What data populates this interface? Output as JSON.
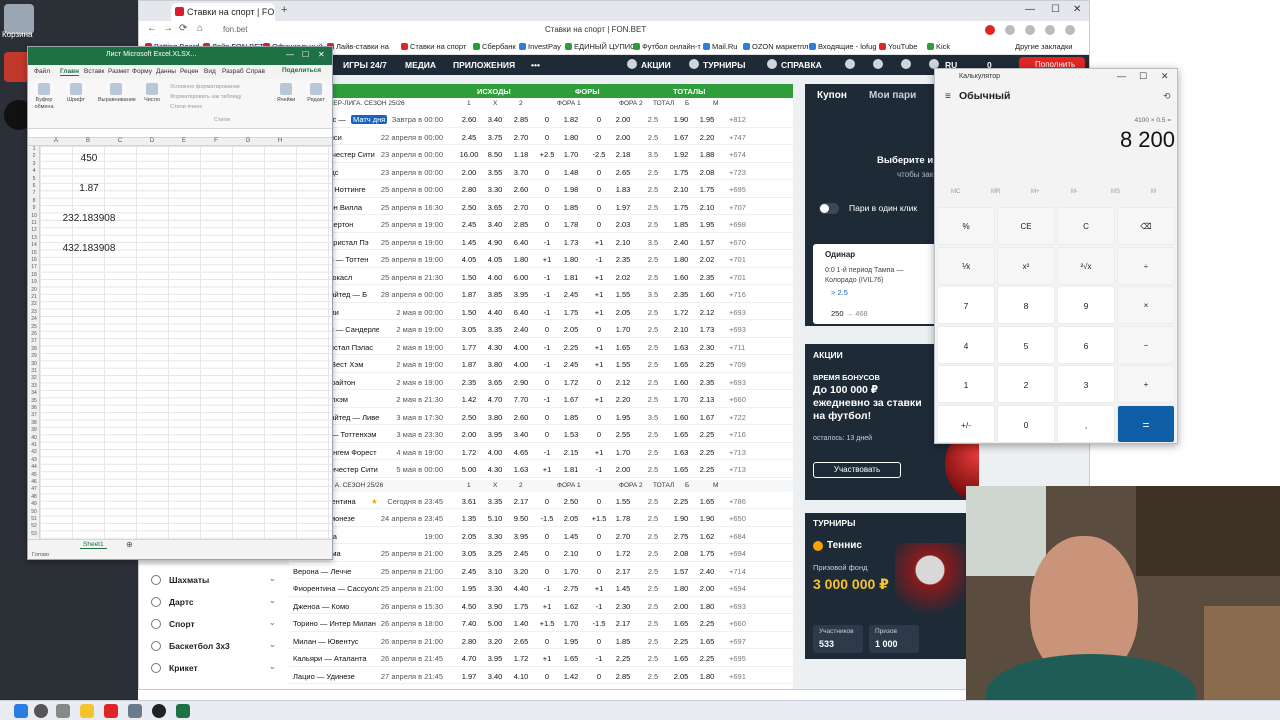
{
  "desktop": {
    "icons": [
      "Корзина"
    ]
  },
  "browser": {
    "tab_title": "Ставки на спорт | FON.BET",
    "url": "fon.bet",
    "page_title": "Ставки на спорт | FON.BET",
    "bookmarks": [
      "Betting Board",
      "Лайв FON.BET",
      "Официальный",
      "Лайв-ставки на",
      "Ставки на спорт",
      "Сбербанк",
      "InvestPay",
      "ЕДИНЫЙ ЦУПИС",
      "Футбол онлайн-т",
      "Mail.Ru",
      "OZON маркетпл",
      "Входящие - lofug",
      "YouTube",
      "Kick",
      "Другие закладки"
    ]
  },
  "fonbet_header": {
    "items": [
      "ИГРЫ 24/7",
      "МЕДИА",
      "ПРИЛОЖЕНИЯ",
      "•••",
      "АКЦИИ",
      "ТУРНИРЫ",
      "СПРАВКА"
    ],
    "lang": "RU",
    "balance": "0",
    "deposit": "Пополнить"
  },
  "odds_table": {
    "section1": {
      "title": "тбол",
      "groups": [
        "ИСХОДЫ",
        "ФОРЫ",
        "ТОТАЛЫ"
      ],
      "league": "ЛИЯ. ПРЕМЬЕР-ЛИГА. СЕЗОН 25/26",
      "cols": [
        "1",
        "X",
        "2",
        "ФОРА 1",
        "ФОРА 2",
        "ТОТАЛ",
        "Б",
        "М"
      ],
      "rows": [
        {
          "team": "истал Пэлас —",
          "badge": "Матч дня",
          "date": "Завтра в 00:00",
          "o": [
            "2.60",
            "3.40",
            "2.85",
            "0",
            "1.82",
            "0",
            "2.00",
            "2.5",
            "1.90",
            "1.95"
          ],
          "more": "+812"
        },
        {
          "team": "йтон — Челси",
          "date": "22 апреля в 00:00",
          "o": [
            "2.45",
            "3.75",
            "2.70",
            "0",
            "1.80",
            "0",
            "2.00",
            "2.5",
            "1.67",
            "2.20"
          ],
          "more": "+747"
        },
        {
          "team": "нли — Манчестер Сити",
          "date": "23 апреля в 00:00",
          "o": [
            "16.00",
            "8.50",
            "1.18",
            "+2.5",
            "1.70",
            "-2.5",
            "2.18",
            "3.5",
            "1.92",
            "1.88"
          ],
          "more": "+674"
        },
        {
          "team": "нмут — Лидс",
          "date": "23 апреля в 00:00",
          "o": [
            "2.00",
            "3.55",
            "3.70",
            "0",
            "1.48",
            "0",
            "2.65",
            "2.5",
            "1.75",
            "2.08"
          ],
          "more": "+723"
        },
        {
          "team": "дерленд — Ноттинге",
          "date": "25 апреля в 00:00",
          "o": [
            "2.80",
            "3.30",
            "2.60",
            "0",
            "1.98",
            "0",
            "1.83",
            "2.5",
            "2.10",
            "1.75"
          ],
          "more": "+695"
        },
        {
          "team": "хэм — Астон Вилла",
          "date": "25 апреля в 16:30",
          "o": [
            "2.50",
            "3.65",
            "2.70",
            "0",
            "1.85",
            "0",
            "1.97",
            "2.5",
            "1.75",
            "2.10"
          ],
          "more": "+707"
        },
        {
          "team": "т Хэм — Эвертон",
          "date": "25 апреля в 19:00",
          "o": [
            "2.45",
            "3.40",
            "2.85",
            "0",
            "1.78",
            "0",
            "2.03",
            "2.5",
            "1.85",
            "1.95"
          ],
          "more": "+698"
        },
        {
          "team": "ерпуль — Кристал Пэ",
          "date": "25 апреля в 19:00",
          "o": [
            "1.45",
            "4.90",
            "6.40",
            "-1",
            "1.73",
            "+1",
            "2.10",
            "3.5",
            "2.40",
            "1.57"
          ],
          "more": "+670"
        },
        {
          "team": "верхэмптон — Тоттен",
          "date": "25 апреля в 19:00",
          "o": [
            "4.05",
            "4.05",
            "1.80",
            "+1",
            "1.80",
            "-1",
            "2.35",
            "2.5",
            "1.80",
            "2.02"
          ],
          "more": "+701"
        },
        {
          "team": "енал — Ньюкасл",
          "date": "25 апреля в 21:30",
          "o": [
            "1.50",
            "4.60",
            "6.00",
            "-1",
            "1.81",
            "+1",
            "2.02",
            "2.5",
            "1.60",
            "2.35"
          ],
          "more": "+701"
        },
        {
          "team": "честер Юнайтед — Б",
          "date": "28 апреля в 00:00",
          "o": [
            "1.87",
            "3.85",
            "3.95",
            "-1",
            "2.45",
            "+1",
            "1.55",
            "3.5",
            "2.35",
            "1.60"
          ],
          "more": "+716"
        },
        {
          "team": "дс — Бернли",
          "date": "2 мая в 00:00",
          "o": [
            "1.50",
            "4.40",
            "6.40",
            "-1",
            "1.75",
            "+1",
            "2.05",
            "2.5",
            "1.72",
            "2.12"
          ],
          "more": "+693"
        },
        {
          "team": "верхэмптон — Сандерленд",
          "date": "2 мая в 19:00",
          "o": [
            "3.05",
            "3.35",
            "2.40",
            "0",
            "2.05",
            "0",
            "1.70",
            "2.5",
            "2.10",
            "1.73"
          ],
          "more": "+693"
        },
        {
          "team": "нмут — Кристал Пэлас",
          "date": "2 мая в 19:00",
          "o": [
            "1.77",
            "4.30",
            "4.00",
            "-1",
            "2.25",
            "+1",
            "1.65",
            "2.5",
            "1.63",
            "2.30"
          ],
          "more": "+711"
        },
        {
          "team": "нтфорд — Вест Хэм",
          "date": "2 мая в 19:00",
          "o": [
            "1.87",
            "3.80",
            "4.00",
            "-1",
            "2.45",
            "+1",
            "1.55",
            "2.5",
            "1.65",
            "2.25"
          ],
          "more": "+709"
        },
        {
          "team": "юкасл — Брайтон",
          "date": "2 мая в 19:00",
          "o": [
            "2.35",
            "3.65",
            "2.90",
            "0",
            "1.72",
            "0",
            "2.12",
            "2.5",
            "1.60",
            "2.35"
          ],
          "more": "+693"
        },
        {
          "team": "енал — Фулхэм",
          "date": "2 мая в 21:30",
          "o": [
            "1.42",
            "4.70",
            "7.70",
            "-1",
            "1.67",
            "+1",
            "2.20",
            "2.5",
            "1.70",
            "2.13"
          ],
          "more": "+660"
        },
        {
          "team": "честер Юнайтед — Ливер",
          "date": "3 мая в 17:30",
          "o": [
            "2.50",
            "3.80",
            "2.60",
            "0",
            "1.85",
            "0",
            "1.95",
            "3.5",
            "1.60",
            "1.67"
          ],
          "more": "+722"
        },
        {
          "team": "тон Вилла — Тоттенхэм",
          "date": "3 мая в 23:30",
          "o": [
            "2.00",
            "3.95",
            "3.40",
            "0",
            "1.53",
            "0",
            "2.55",
            "2.5",
            "1.65",
            "2.25"
          ],
          "more": "+716"
        },
        {
          "team": "си — Ноттингем Форест",
          "date": "4 мая в 19:00",
          "o": [
            "1.72",
            "4.00",
            "4.65",
            "-1",
            "2.15",
            "+1",
            "1.70",
            "2.5",
            "1.63",
            "2.25"
          ],
          "more": "+713"
        },
        {
          "team": "ртон — Манчестер Сити",
          "date": "5 мая в 00:00",
          "o": [
            "5.00",
            "4.30",
            "1.63",
            "+1",
            "1.81",
            "-1",
            "2.00",
            "2.5",
            "1.65",
            "2.25"
          ],
          "more": "+713"
        }
      ]
    },
    "section2": {
      "league": "ЛИЯ. СЕРИЯ А. СЕЗОН 25/26",
      "cols": [
        "1",
        "X",
        "2",
        "ФОРА 1",
        "ФОРА 2",
        "ТОТАЛ",
        "Б",
        "М"
      ],
      "rows": [
        {
          "team": "ли — Фиорентина",
          "date": "Сегодня в 23:45",
          "star": true,
          "o": [
            "3.61",
            "3.35",
            "2.17",
            "0",
            "2.50",
            "0",
            "1.55",
            "2.5",
            "2.25",
            "1.65"
          ],
          "more": "+786"
        },
        {
          "team": "оли — Кремонезе",
          "date": "24 апреля в 23:45",
          "o": [
            "1.35",
            "5.10",
            "9.50",
            "-1.5",
            "2.05",
            "+1.5",
            "1.78",
            "2.5",
            "1.90",
            "1.90"
          ],
          "more": "+650"
        },
        {
          "team": "нтус — Пиза",
          "date": "19:00",
          "o": [
            "2.05",
            "3.30",
            "3.95",
            "0",
            "1.45",
            "0",
            "2.70",
            "2.5",
            "2.75",
            "1.62"
          ],
          "more": "+684"
        },
        {
          "team": "ньюа — Рома",
          "date": "25 апреля в 21:00",
          "o": [
            "3.05",
            "3.25",
            "2.45",
            "0",
            "2.10",
            "0",
            "1.72",
            "2.5",
            "2.08",
            "1.75"
          ],
          "more": "+694"
        },
        {
          "team": "Верона — Лечче",
          "date": "25 апреля в 21:00",
          "o": [
            "2.45",
            "3.10",
            "3.20",
            "0",
            "1.70",
            "0",
            "2.17",
            "2.5",
            "1.57",
            "2.40"
          ],
          "more": "+714"
        },
        {
          "team": "Фиорентина — Сассуоло",
          "date": "25 апреля в 21:00",
          "o": [
            "1.95",
            "3.30",
            "4.40",
            "-1",
            "2.75",
            "+1",
            "1.45",
            "2.5",
            "1.80",
            "2.00"
          ],
          "more": "+694"
        },
        {
          "team": "Дженоа — Комо",
          "date": "26 апреля в 15:30",
          "o": [
            "4.50",
            "3.90",
            "1.75",
            "+1",
            "1.62",
            "-1",
            "2.30",
            "2.5",
            "2.00",
            "1.80"
          ],
          "more": "+693"
        },
        {
          "team": "Торино — Интер Милан",
          "date": "26 апреля в 18:00",
          "o": [
            "7.40",
            "5.00",
            "1.40",
            "+1.5",
            "1.70",
            "-1.5",
            "2.17",
            "2.5",
            "1.65",
            "2.25"
          ],
          "more": "+660"
        },
        {
          "team": "Милан — Ювентус",
          "date": "26 апреля в 21:00",
          "o": [
            "2.80",
            "3.20",
            "2.65",
            "0",
            "1.95",
            "0",
            "1.85",
            "2.5",
            "2.25",
            "1.65"
          ],
          "more": "+697"
        },
        {
          "team": "Кальяри — Аталанта",
          "date": "26 апреля в 21:45",
          "o": [
            "4.70",
            "3.95",
            "1.72",
            "+1",
            "1.65",
            "-1",
            "2.25",
            "2.5",
            "1.65",
            "2.25"
          ],
          "more": "+695"
        },
        {
          "team": "Лацио — Удинезе",
          "date": "27 апреля в 21:45",
          "o": [
            "1.97",
            "3.40",
            "4.10",
            "0",
            "1.42",
            "0",
            "2.85",
            "2.5",
            "2.05",
            "1.80"
          ],
          "more": "+691"
        }
      ]
    }
  },
  "sports_sidebar": [
    "Шахматы",
    "Дартс",
    "Спорт",
    "Баскетбол 3х3",
    "Крикет"
  ],
  "coupon": {
    "title": "Купон",
    "tab2": "Мои пари",
    "choose": "Выберите и",
    "choose2": "чтобы зак",
    "one_click": "Пари в один клик",
    "bet_type": "Одинар",
    "bet_desc": "0:0 1-й период Тампа — Колорадо (IVIL76)",
    "bet_odd": "> 2.5",
    "bet_amount": "250",
    "bet_win": "→ 468"
  },
  "promo": {
    "header": "АКЦИИ",
    "sub": "ВРЕМЯ БОНУСОВ",
    "big": "До 100 000 ₽ ежедневно за ставки на футбол!",
    "left": "осталось: 13 дней",
    "button": "Участвовать"
  },
  "tournaments": {
    "header": "ТУРНИРЫ",
    "sport": "Теннис",
    "fund_label": "Призовой фонд",
    "fund": "3 000 000 ₽",
    "participants_label": "Участников",
    "participants": "533",
    "prizes_label": "Призов",
    "prizes": "1 000"
  },
  "excel": {
    "title": "Лист Microsoft Excel.XLSX...",
    "menu": [
      "Файл",
      "Главн",
      "Вставк",
      "Размет",
      "Форму",
      "Данны",
      "Рецен",
      "Вид",
      "Разраб",
      "Справ"
    ],
    "share": "Поделиться",
    "ribbon": [
      "Буфер обмена",
      "Шрифт",
      "Выравнивание",
      "Число",
      "Ячейки",
      "Редакт"
    ],
    "ribbon_small": [
      "Условное форматирование",
      "Форматировать как таблицу",
      "Стили ячеек"
    ],
    "ribbon_group": "Стили",
    "columns": [
      "A",
      "B",
      "C",
      "D",
      "E",
      "F",
      "G",
      "H"
    ],
    "values": [
      "450",
      "1.87",
      "232.183908",
      "432.183908"
    ],
    "sheet": "Sheet1",
    "status": "Готово"
  },
  "calculator": {
    "title": "Калькулятор",
    "mode": "Обычный",
    "expression": "4100 × 0.5 =",
    "display": "8 200",
    "memory": [
      "MC",
      "MR",
      "M+",
      "M-",
      "MS",
      "M"
    ],
    "keys": [
      "%",
      "CE",
      "C",
      "⌫",
      "⅟x",
      "x²",
      "²√x",
      "÷",
      "7",
      "8",
      "9",
      "×",
      "4",
      "5",
      "6",
      "−",
      "1",
      "2",
      "3",
      "+",
      "+/-",
      "0",
      ",",
      "="
    ]
  }
}
